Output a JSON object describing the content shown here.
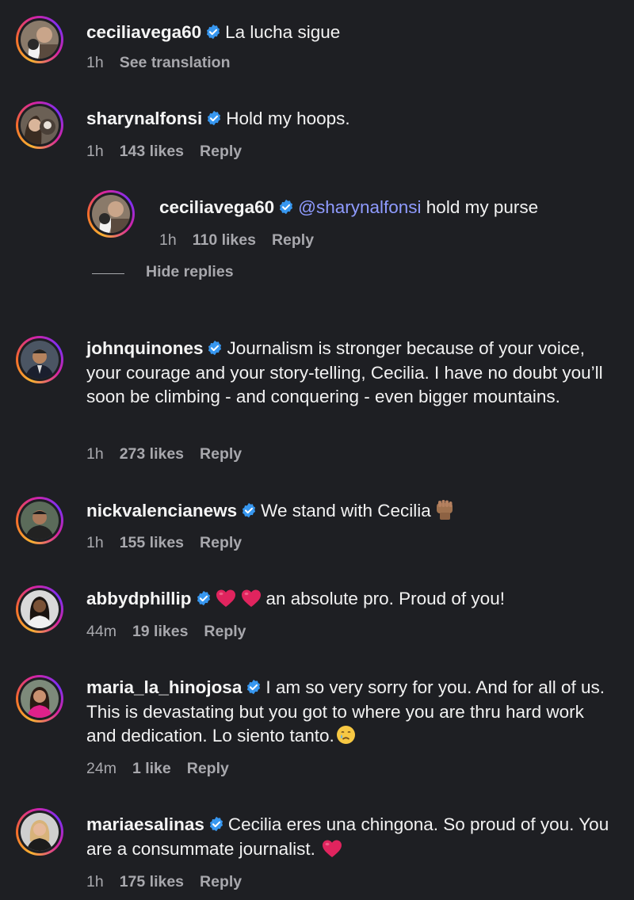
{
  "comments": [
    {
      "username": "ceciliavega60",
      "text": "La lucha sigue",
      "time": "1h",
      "likes": "",
      "action": "See translation"
    },
    {
      "username": "sharynalfonsi",
      "text": "Hold my hoops.",
      "time": "1h",
      "likes": "143 likes",
      "action": "Reply"
    },
    {
      "username": "johnquinones",
      "text": "Journalism is stronger because of your voice, your courage and your story-telling, Cecilia. I have no doubt you’ll soon be climbing - and conquering - even bigger mountains.",
      "time": "1h",
      "likes": "273 likes",
      "action": "Reply"
    },
    {
      "username": "nickvalencianews",
      "text": "We stand with Cecilia",
      "time": "1h",
      "likes": "155 likes",
      "action": "Reply"
    },
    {
      "username": "abbydphillip",
      "text": "an absolute pro. Proud of you!",
      "time": "44m",
      "likes": "19 likes",
      "action": "Reply"
    },
    {
      "username": "maria_la_hinojosa",
      "text": "I am so very sorry for you. And for all of us. This is devastating but you got to where you are thru hard work and dedication. Lo siento tanto.",
      "time": "24m",
      "likes": "1 like",
      "action": "Reply"
    },
    {
      "username": "mariaesalinas",
      "text": "Cecilia eres una chingona. So proud of you. You are a consummate journalist.",
      "time": "1h",
      "likes": "175 likes",
      "action": "Reply"
    }
  ],
  "reply": {
    "username": "ceciliavega60",
    "mention": "@sharynalfonsi",
    "text": " hold my purse",
    "time": "1h",
    "likes": "110 likes",
    "action": "Reply"
  },
  "hide_replies_label": "Hide replies",
  "colors": {
    "background": "#1e1f23",
    "verified": "#3797f0",
    "mention": "#8f9bff",
    "meta": "#a8a8ad"
  },
  "icons": {
    "verified": "verified-badge-icon",
    "heart": "red-heart-emoji",
    "fist": "raised-fist-emoji",
    "crying": "crying-face-emoji"
  }
}
